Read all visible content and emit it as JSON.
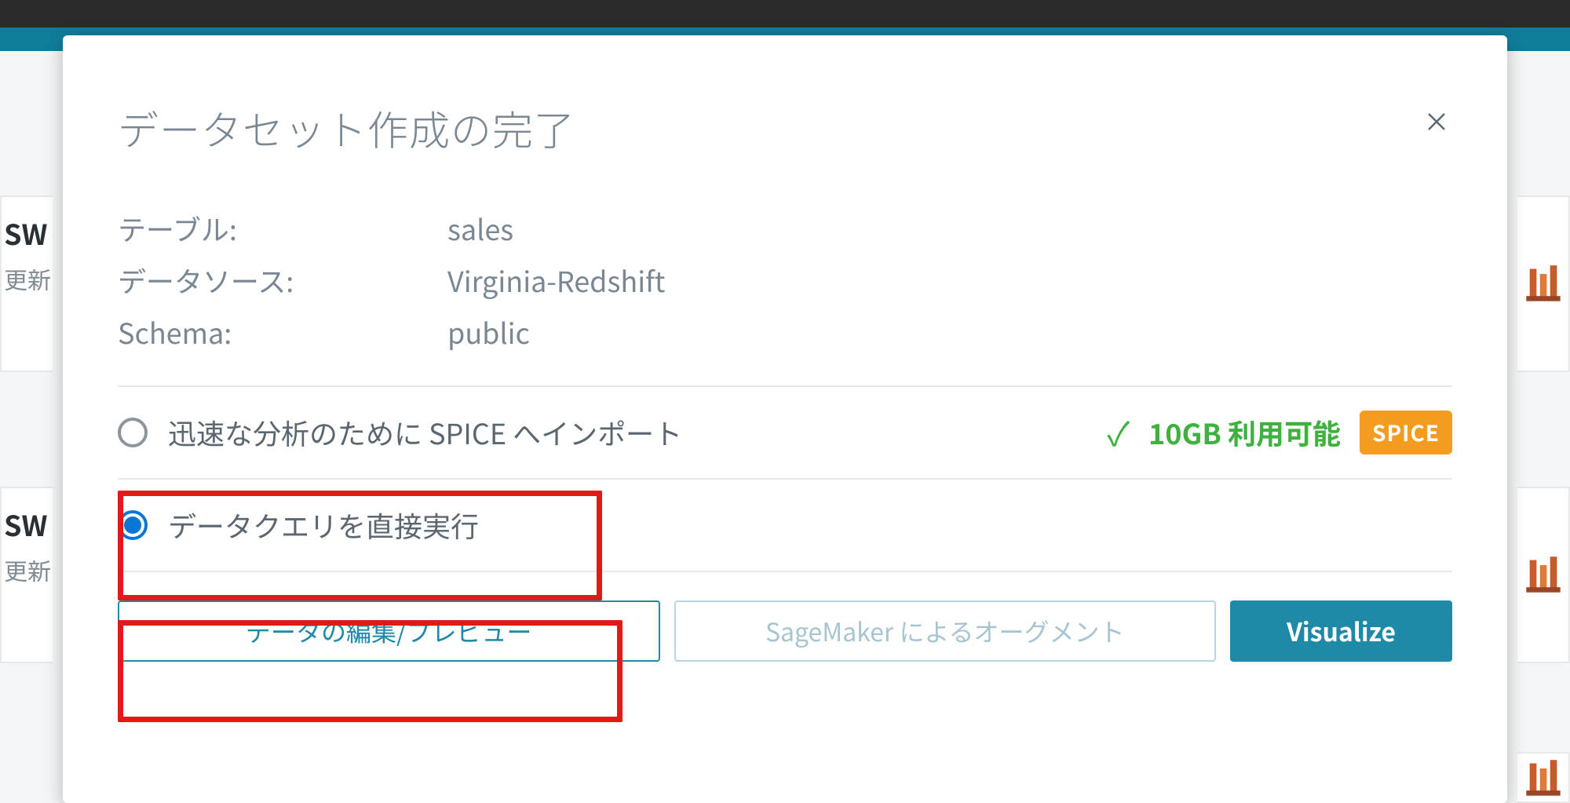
{
  "modal": {
    "title": "データセット作成の完了",
    "info": {
      "tableLabel": "テーブル:",
      "tableValue": "sales",
      "sourceLabel": "データソース:",
      "sourceValue": "Virginia-Redshift",
      "schemaLabel": "Schema:",
      "schemaValue": "public"
    },
    "options": {
      "spiceImport": "迅速な分析のために SPICE へインポート",
      "directQuery": "データクエリを直接実行",
      "spiceAvailable": "10GB 利用可能",
      "spiceBadge": "SPICE"
    },
    "buttons": {
      "editPreview": "データの編集/プレビュー",
      "sagemaker": "SageMaker によるオーグメント",
      "visualize": "Visualize"
    }
  },
  "background": {
    "cardTitle": "SW",
    "cardSub": "更新"
  }
}
